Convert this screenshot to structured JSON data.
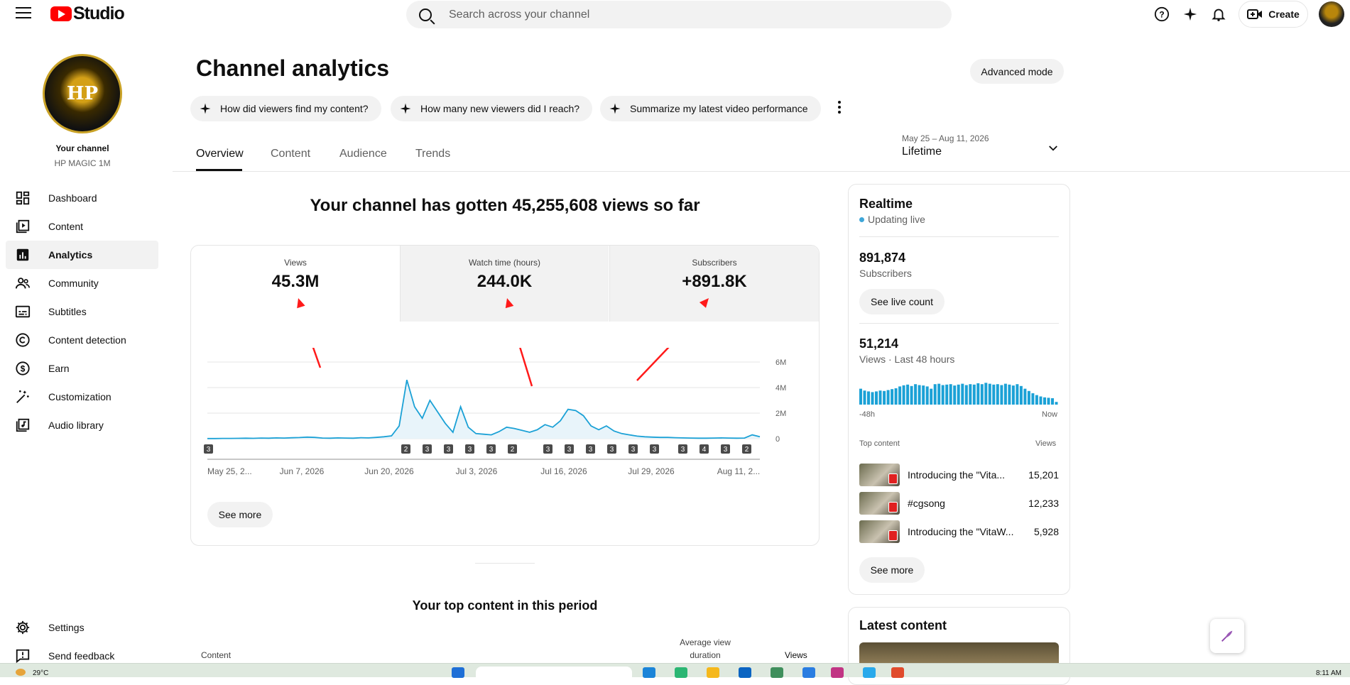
{
  "app": {
    "logo_text": "Studio",
    "search_placeholder": "Search across your channel",
    "create_label": "Create"
  },
  "sidebar": {
    "avatar_text": "HP",
    "your_channel_label": "Your channel",
    "channel_name": "HP MAGIC 1M",
    "items": [
      {
        "label": "Dashboard",
        "icon": "dashboard-icon"
      },
      {
        "label": "Content",
        "icon": "content-icon"
      },
      {
        "label": "Analytics",
        "icon": "analytics-icon",
        "active": true
      },
      {
        "label": "Community",
        "icon": "community-icon"
      },
      {
        "label": "Subtitles",
        "icon": "subtitles-icon"
      },
      {
        "label": "Content detection",
        "icon": "copyright-icon"
      },
      {
        "label": "Earn",
        "icon": "dollar-icon"
      },
      {
        "label": "Customization",
        "icon": "magic-wand-icon"
      },
      {
        "label": "Audio library",
        "icon": "audio-library-icon"
      }
    ],
    "settings_label": "Settings",
    "feedback_label": "Send feedback"
  },
  "header": {
    "title": "Channel analytics",
    "advanced_mode_label": "Advanced mode",
    "suggestions": [
      "How did viewers find my content?",
      "How many new viewers did I reach?",
      "Summarize my latest video performance"
    ],
    "tabs": [
      "Overview",
      "Content",
      "Audience",
      "Trends"
    ],
    "date_range": "May 25 – Aug 11, 2026",
    "period": "Lifetime"
  },
  "overview": {
    "headline": "Your channel has gotten 45,255,608 views so far",
    "metrics": [
      {
        "label": "Views",
        "value": "45.3M"
      },
      {
        "label": "Watch time (hours)",
        "value": "244.0K"
      },
      {
        "label": "Subscribers",
        "value": "+891.8K"
      }
    ],
    "see_more_label": "See more",
    "top_content_title": "Your top content in this period",
    "table_headers": {
      "content": "Content",
      "avg_view_duration_line1": "Average view",
      "avg_view_duration_line2": "duration",
      "views": "Views"
    }
  },
  "chart_data": {
    "type": "area",
    "series": [
      {
        "values": [
          0.01,
          0.01,
          0.02,
          0.02,
          0.03,
          0.04,
          0.03,
          0.05,
          0.04,
          0.06,
          0.05,
          0.07,
          0.09,
          0.12,
          0.1,
          0.05,
          0.04,
          0.06,
          0.05,
          0.04,
          0.08,
          0.06,
          0.1,
          0.15,
          0.22,
          1.0,
          4.6,
          2.5,
          1.6,
          3.0,
          2.1,
          1.2,
          0.5,
          2.5,
          0.9,
          0.4,
          0.35,
          0.3,
          0.55,
          0.9,
          0.8,
          0.65,
          0.5,
          0.7,
          1.1,
          0.9,
          1.4,
          2.3,
          2.2,
          1.8,
          1.0,
          0.7,
          1.0,
          0.6,
          0.4,
          0.3,
          0.2,
          0.15,
          0.12,
          0.1,
          0.1,
          0.08,
          0.06,
          0.05,
          0.04,
          0.04,
          0.05,
          0.06,
          0.05,
          0.04,
          0.05,
          0.3,
          0.15
        ]
      }
    ],
    "x_tick_labels": [
      "May 25, 2...",
      "Jun 7, 2026",
      "Jun 20, 2026",
      "Jul 3, 2026",
      "Jul 16, 2026",
      "Jul 29, 2026",
      "Aug 11, 2..."
    ],
    "y_tick_labels": [
      "6M",
      "4M",
      "2M",
      "0"
    ],
    "ylim": [
      0,
      6
    ],
    "grid": true,
    "upload_markers": [
      "3",
      "2",
      "3",
      "3",
      "3",
      "3",
      "2",
      "3",
      "3",
      "3",
      "3",
      "3",
      "3",
      "3",
      "4",
      "3",
      "2"
    ]
  },
  "realtime": {
    "title": "Realtime",
    "status": "Updating live",
    "subscribers_value": "891,874",
    "subscribers_label": "Subscribers",
    "see_live_count_label": "See live count",
    "views_value": "51,214",
    "views_label": "Views · Last 48 hours",
    "bars": [
      0.7,
      0.62,
      0.58,
      0.55,
      0.58,
      0.62,
      0.6,
      0.64,
      0.68,
      0.72,
      0.8,
      0.85,
      0.88,
      0.82,
      0.9,
      0.86,
      0.84,
      0.8,
      0.7,
      0.9,
      0.92,
      0.86,
      0.88,
      0.9,
      0.84,
      0.88,
      0.92,
      0.86,
      0.9,
      0.88,
      0.94,
      0.9,
      0.96,
      0.92,
      0.88,
      0.9,
      0.86,
      0.92,
      0.88,
      0.84,
      0.9,
      0.82,
      0.7,
      0.6,
      0.5,
      0.42,
      0.36,
      0.32,
      0.3,
      0.28,
      0.12
    ],
    "axis_start": "-48h",
    "axis_end": "Now",
    "top_content_label": "Top content",
    "views_col_label": "Views",
    "top_content": [
      {
        "title": "Introducing the \"Vita...",
        "views": "15,201"
      },
      {
        "title": "#cgsong",
        "views": "12,233"
      },
      {
        "title": "Introducing the \"VitaW...",
        "views": "5,928"
      }
    ],
    "see_more_label": "See more"
  },
  "latest": {
    "title": "Latest content"
  },
  "taskbar": {
    "temperature": "29°C",
    "time": "8:11 AM"
  },
  "colors": {
    "accent": "#ff0000",
    "chart_line": "#1ba1d6",
    "chart_fill": "#e8f4fa",
    "arrow": "#ff1a1a"
  }
}
